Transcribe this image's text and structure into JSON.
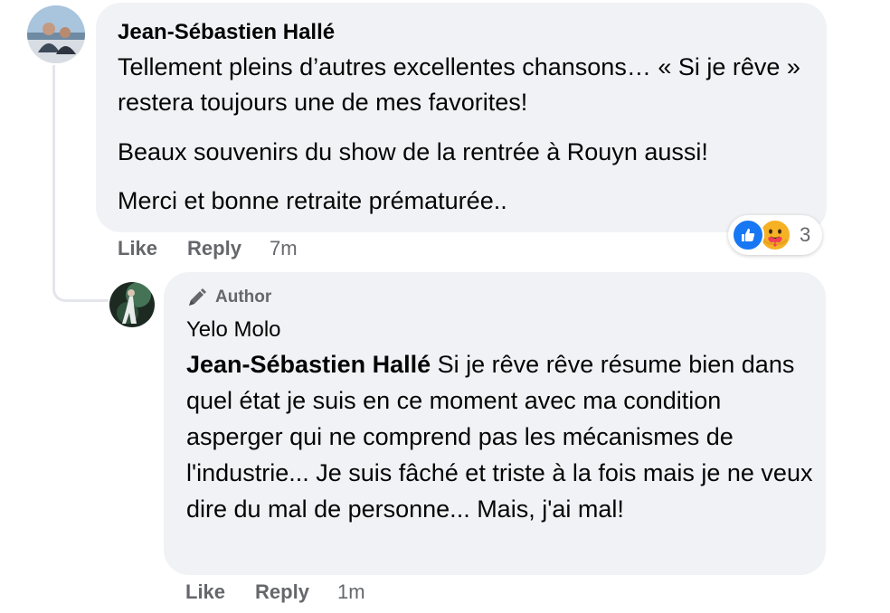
{
  "comment": {
    "author": "Jean-Sébastien Hallé",
    "paragraphs": [
      "Tellement pleins d’autres excellentes chansons… « Si je rêve » restera toujours une de mes favorites!",
      "Beaux souvenirs du show de la rentrée à Rouyn aussi!",
      "Merci et bonne retraite prématurée.."
    ],
    "actions": {
      "like": "Like",
      "reply": "Reply",
      "time": "7m"
    },
    "reactions": {
      "icons": [
        "like-icon",
        "care-icon"
      ],
      "count": "3"
    }
  },
  "reply": {
    "badge": "Author",
    "badge_icon": "pen-icon",
    "author": "Yelo Molo",
    "mention": "Jean-Sébastien Hallé",
    "text": "Si je rêve rêve résume bien dans quel état je suis en ce moment avec ma condition asperger qui ne comprend pas les mécanismes de l'industrie... Je suis fâché et triste à la fois mais je ne veux dire du mal de personne... Mais, j'ai mal!",
    "actions": {
      "like": "Like",
      "reply": "Reply",
      "time": "1m"
    }
  },
  "colors": {
    "bubble": "#f0f2f5",
    "secondary_text": "#65676b",
    "like_blue": "#1877f2",
    "care_yellow": "#f7b125",
    "thread_line": "#e4e6eb"
  }
}
